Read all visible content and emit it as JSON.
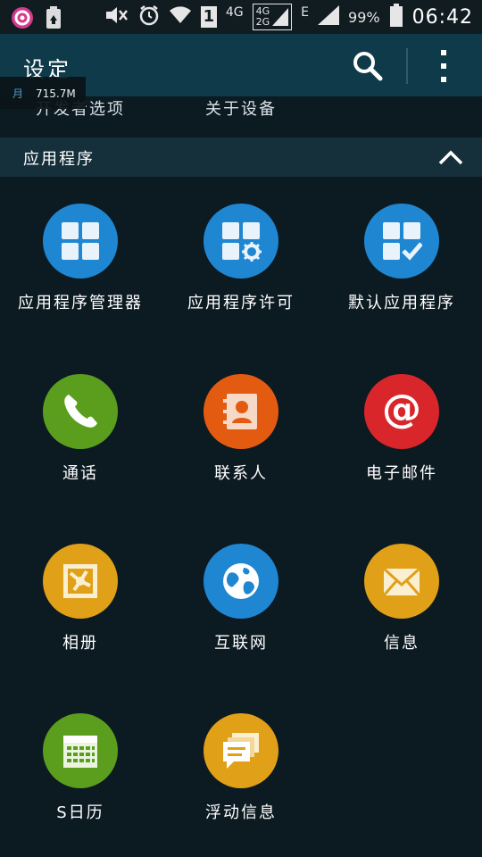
{
  "status_bar": {
    "network_4g": "4G",
    "network_4g_box": "4G",
    "network_2g_box": "2G",
    "sim_number": "1",
    "network_e": "E",
    "battery_percent": "99%",
    "time": "06:42"
  },
  "action_bar": {
    "title": "设定"
  },
  "memory_overlay": {
    "label": "月",
    "value": "715.7M"
  },
  "partial_row": {
    "left": "开发者选项",
    "right": "关于设备"
  },
  "section": {
    "title": "应用程序"
  },
  "colors": {
    "blue": "#1f86d1",
    "green": "#5b9e1e",
    "orange": "#e35b11",
    "red": "#d8262b",
    "gold": "#e0a018",
    "action_bar": "#0f3a4a",
    "section_header": "#16303b",
    "background": "#0c1a22"
  },
  "apps": [
    {
      "label": "应用程序管理器",
      "icon": "app-manager-icon"
    },
    {
      "label": "应用程序许可",
      "icon": "app-permissions-icon"
    },
    {
      "label": "默认应用程序",
      "icon": "default-apps-icon"
    },
    {
      "label": "通话",
      "icon": "phone-icon"
    },
    {
      "label": "联系人",
      "icon": "contacts-icon"
    },
    {
      "label": "电子邮件",
      "icon": "email-icon"
    },
    {
      "label": "相册",
      "icon": "gallery-icon"
    },
    {
      "label": "互联网",
      "icon": "internet-icon"
    },
    {
      "label": "信息",
      "icon": "message-icon"
    },
    {
      "label": "S日历",
      "icon": "calendar-icon"
    },
    {
      "label": "浮动信息",
      "icon": "floating-message-icon"
    }
  ]
}
